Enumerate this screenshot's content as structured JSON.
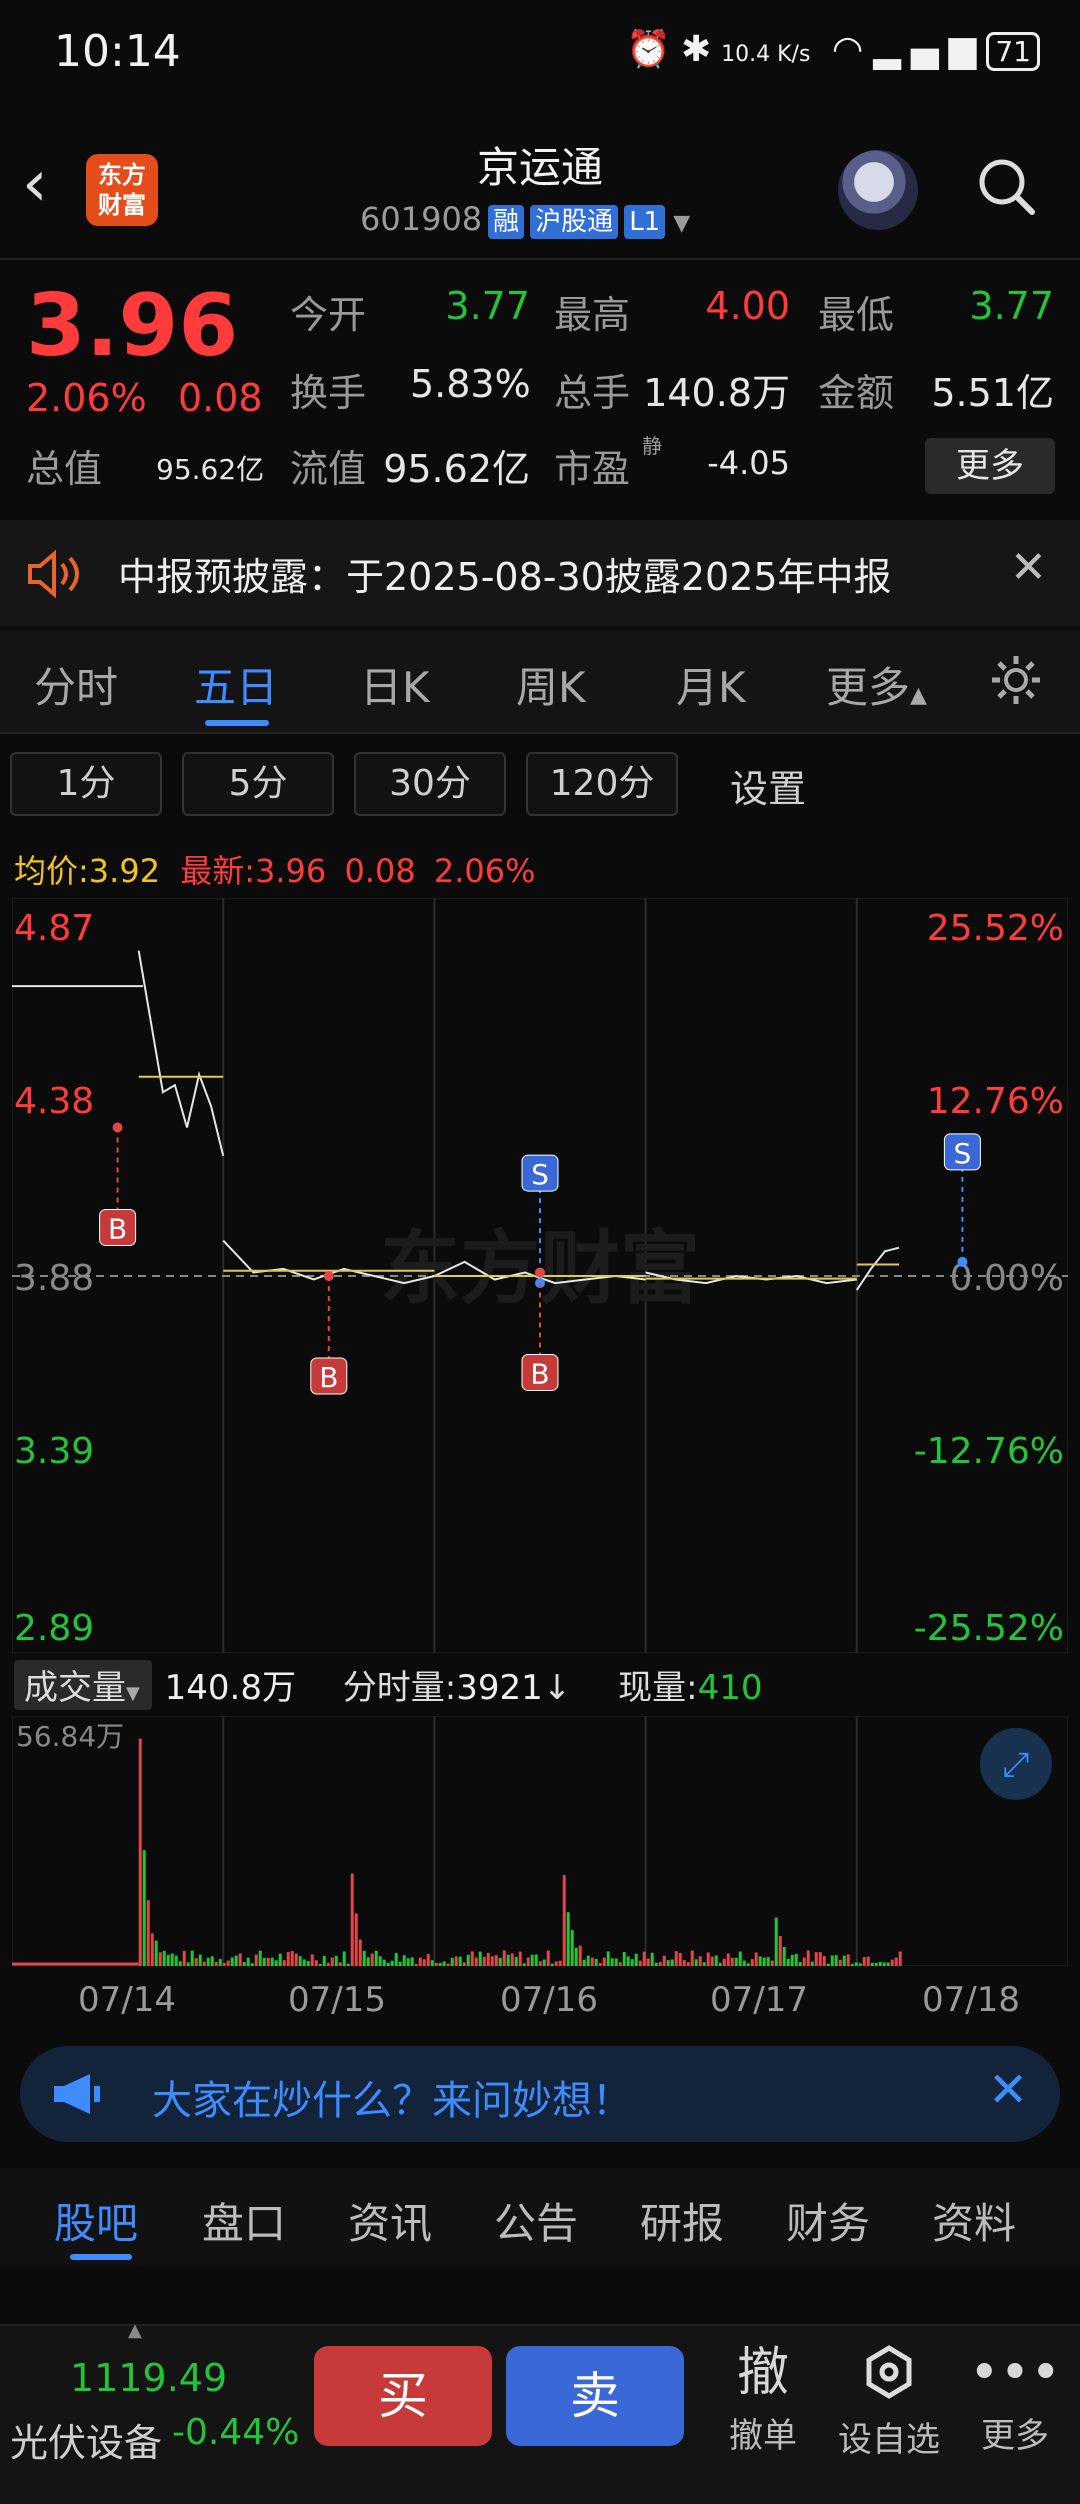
{
  "status": {
    "time": "10:14",
    "net_speed": "10.4 K/s",
    "battery": "71"
  },
  "header": {
    "logo_text": "东方财富",
    "stock_name": "京运通",
    "stock_code": "601908",
    "badges": [
      "融",
      "沪股通",
      "L1"
    ]
  },
  "quote": {
    "price": "3.96",
    "change_pct": "2.06%",
    "change": "0.08",
    "total_value_label": "总值",
    "total_value": "95.62亿",
    "open_label": "今开",
    "open": "3.77",
    "high_label": "最高",
    "high": "4.00",
    "low_label": "最低",
    "low": "3.77",
    "turnover_label": "换手",
    "turnover": "5.83%",
    "volume_label": "总手",
    "volume": "140.8万",
    "amount_label": "金额",
    "amount": "5.51亿",
    "float_label": "流值",
    "float_value": "95.62亿",
    "pe_label": "市盈",
    "pe_sup": "静",
    "pe": "-4.05",
    "more": "更多"
  },
  "notice": {
    "text": "中报预披露：于2025-08-30披露2025年中报"
  },
  "tabs": [
    "分时",
    "五日",
    "日K",
    "周K",
    "月K",
    "更多"
  ],
  "period_buttons": [
    "1分",
    "5分",
    "30分",
    "120分"
  ],
  "settings_label": "设置",
  "avg_line": {
    "avg_label": "均价:",
    "avg": "3.92",
    "latest_label": "最新:",
    "latest": "3.96",
    "change": "0.08",
    "pct": "2.06%"
  },
  "chart_data": {
    "type": "line",
    "left_ticks": [
      "4.87",
      "4.38",
      "3.88",
      "3.39",
      "2.89"
    ],
    "right_ticks": [
      "25.52%",
      "12.76%",
      "0.00%",
      "-12.76%",
      "-25.52%"
    ],
    "x": [
      "07/14",
      "07/15",
      "07/16",
      "07/17",
      "07/18"
    ],
    "prev_close": 3.88,
    "ylim": [
      2.89,
      4.87
    ],
    "watermark": "东方财富",
    "series": [
      {
        "values": [
          4.8,
          4.6,
          4.4,
          4.42,
          4.3,
          4.45,
          4.36,
          4.22
        ]
      },
      {
        "values": [
          3.98,
          3.89,
          3.9,
          3.87,
          3.9,
          3.88,
          3.86,
          3.88
        ]
      },
      {
        "values": [
          3.88,
          3.92,
          3.87,
          3.89,
          3.86,
          3.87,
          3.88,
          3.87
        ]
      },
      {
        "values": [
          3.89,
          3.87,
          3.86,
          3.88,
          3.87,
          3.88,
          3.86,
          3.87
        ]
      },
      {
        "values": [
          3.84,
          3.9,
          3.95,
          3.96
        ]
      }
    ],
    "markers": [
      {
        "label": "B",
        "day": 0,
        "price": 4.3
      },
      {
        "label": "B",
        "day": 1,
        "price": 3.88
      },
      {
        "label": "S",
        "day": 2,
        "price": 3.86
      },
      {
        "label": "B",
        "day": 2,
        "price": 3.89
      },
      {
        "label": "S",
        "day": 4,
        "price": 3.92
      }
    ]
  },
  "volume": {
    "selector": "成交量",
    "total": "140.8万",
    "tick_label": "分时量:",
    "tick_value": "3921",
    "current_label": "现量:",
    "current": "410",
    "max_label": "56.84万"
  },
  "ask": {
    "text": "大家在炒什么？来问妙想！"
  },
  "bottom_tabs": [
    "股吧",
    "盘口",
    "资讯",
    "公告",
    "研报",
    "财务",
    "资料"
  ],
  "bottom_bar": {
    "index_value": "1119.49",
    "index_name": "光伏设备",
    "index_pct": "-0.44%",
    "buy": "买",
    "sell": "卖",
    "cancel_icon": "撤",
    "cancel": "撤单",
    "watch": "设自选",
    "more": "更多"
  }
}
